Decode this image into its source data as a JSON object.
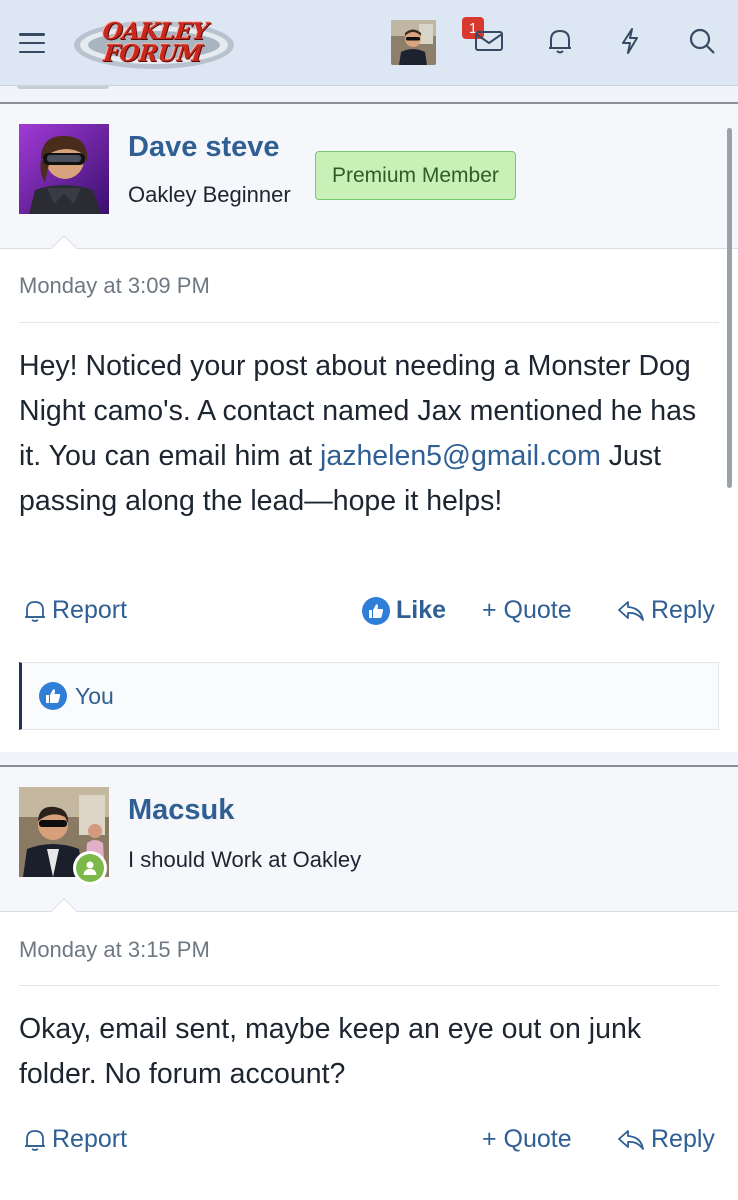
{
  "header": {
    "logo_line1": "OAKLEY",
    "logo_line2": "FORUM",
    "inbox_badge": "1",
    "icons": [
      "menu-icon",
      "inbox-icon",
      "bell-icon",
      "bolt-icon",
      "search-icon"
    ]
  },
  "posts": [
    {
      "username": "Dave steve",
      "user_title": "Oakley Beginner",
      "banner": "Premium Member",
      "timestamp": "Monday at 3:09 PM",
      "body_before_link": "Hey! Noticed your post about needing a Monster Dog Night camo's. A contact named Jax mentioned he has it. You can email him at ",
      "link": "jazhelen5@gmail.com",
      "body_after_link": " Just passing along the lead—hope it helps!",
      "actions": {
        "report": "Report",
        "like": "Like",
        "quote": "+ Quote",
        "reply": "Reply"
      },
      "reactions": "You"
    },
    {
      "username": "Macsuk",
      "user_title": "I should Work at Oakley",
      "timestamp": "Monday at 3:15 PM",
      "body": "Okay, email sent, maybe keep an eye out on junk folder. No forum account?",
      "actions": {
        "report": "Report",
        "quote": "+ Quote",
        "reply": "Reply"
      }
    }
  ],
  "colors": {
    "header_bg": "#dce7f3",
    "link": "#2f5f93",
    "premium_bg": "#c8f0b7",
    "badge": "#d8392f",
    "online": "#7cb94a"
  }
}
